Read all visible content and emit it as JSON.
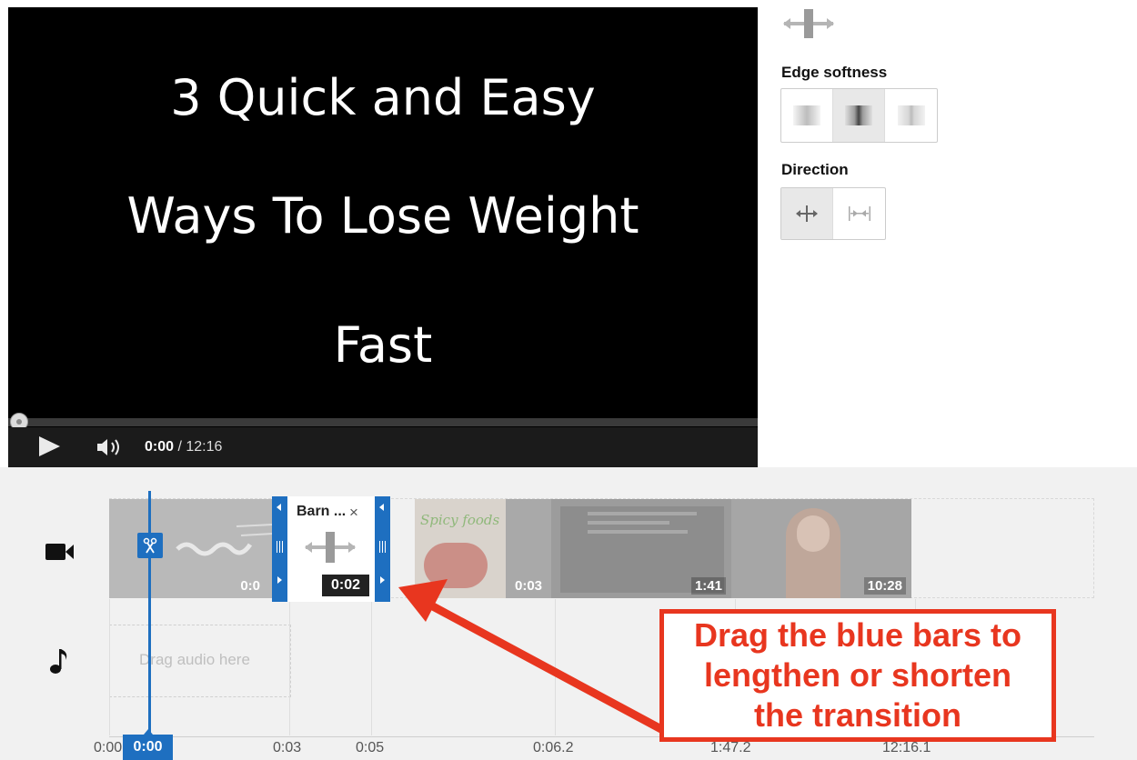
{
  "player": {
    "title_lines": [
      "3 Quick and Easy",
      "Ways To Lose Weight",
      "Fast"
    ],
    "current_time": "0:00",
    "separator": " / ",
    "duration": "12:16",
    "progress_fraction": 0
  },
  "transition_panel": {
    "edge_softness_label": "Edge softness",
    "direction_label": "Direction",
    "edge_softness_selected_index": 1,
    "direction_selected_index": 0
  },
  "editor": {
    "playhead_time": "0:00",
    "audio_placeholder": "Drag audio here",
    "transition": {
      "name": "Barn ...",
      "close": "×",
      "duration": "0:02"
    },
    "clips": [
      {
        "duration": "0:0"
      },
      {
        "duration": "0:03",
        "text": "Spicy foods"
      },
      {
        "duration": "1:41"
      },
      {
        "duration": "10:28"
      }
    ],
    "ruler": [
      "0:00",
      "0:03",
      "0:05",
      "0:06.2",
      "1:47.2",
      "12:16.1"
    ]
  },
  "annotation": {
    "lines": [
      "Drag the blue bars to",
      "lengthen or shorten",
      "the transition"
    ],
    "color": "#e8361f"
  },
  "colors": {
    "accent": "#1e6fc0",
    "player_bg": "#000000",
    "editor_bg": "#f1f1f1"
  }
}
